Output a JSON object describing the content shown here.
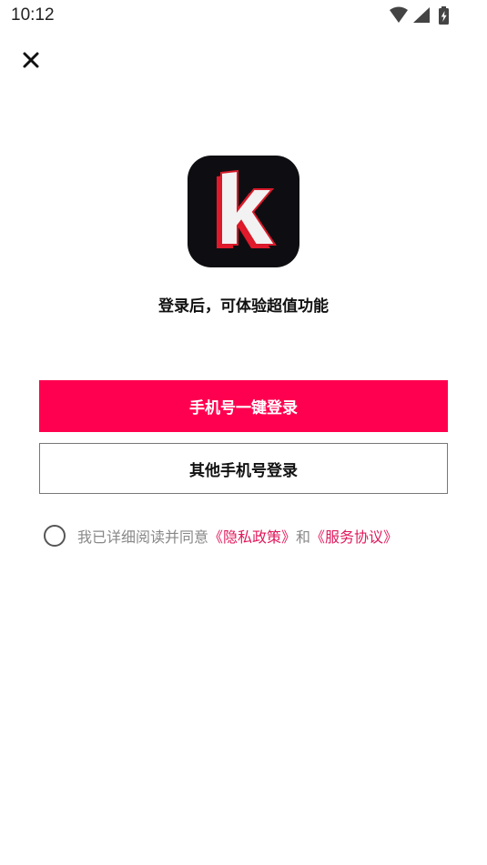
{
  "status_bar": {
    "time": "10:12",
    "icons": [
      "wifi-icon",
      "cellular-signal-icon",
      "battery-charging-icon"
    ]
  },
  "header": {
    "close_icon": "close-icon"
  },
  "app": {
    "logo_letter": "k",
    "logo_bg_color": "#0e0e12",
    "logo_accent_color": "#e0192b"
  },
  "tagline": "登录后，可体验超值功能",
  "buttons": {
    "one_click_login": "手机号一键登录",
    "other_phone_login": "其他手机号登录",
    "primary_color": "#ff0050"
  },
  "agreement": {
    "checked": false,
    "prefix": "我已详细阅读并同意",
    "privacy_link": "《隐私政策》",
    "conjunction": "和",
    "service_link": "《服务协议》",
    "link_color": "#e0195b"
  }
}
